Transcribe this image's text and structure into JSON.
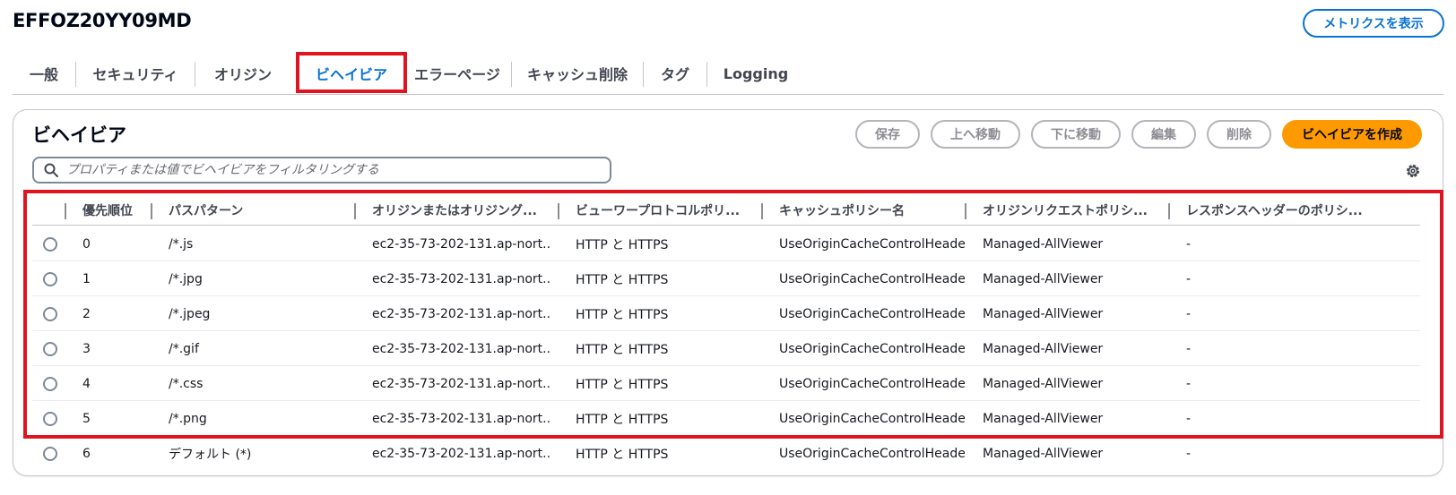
{
  "header": {
    "title": "EFFOZ20YY09MD",
    "metrics_button": "メトリクスを表示"
  },
  "tabs": [
    {
      "label": "一般",
      "active": false
    },
    {
      "label": "セキュリティ",
      "active": false
    },
    {
      "label": "オリジン",
      "active": false
    },
    {
      "label": "ビヘイビア",
      "active": true
    },
    {
      "label": "エラーページ",
      "active": false
    },
    {
      "label": "キャッシュ削除",
      "active": false
    },
    {
      "label": "タグ",
      "active": false
    },
    {
      "label": "Logging",
      "active": false
    }
  ],
  "panel": {
    "title": "ビヘイビア",
    "actions": {
      "save": "保存",
      "move_up": "上へ移動",
      "move_down": "下に移動",
      "edit": "編集",
      "delete": "削除",
      "create": "ビヘイビアを作成"
    },
    "filter_placeholder": "プロパティまたは値でビヘイビアをフィルタリングする"
  },
  "table": {
    "columns": [
      "優先順位",
      "パスパターン",
      "オリジンまたはオリジング...",
      "ビューワープロトコルポリ...",
      "キャッシュポリシー名",
      "オリジンリクエストポリシ...",
      "レスポンスヘッダーのポリシ..."
    ],
    "rows": [
      {
        "priority": "0",
        "path": "/*.js",
        "origin": "ec2-35-73-202-131.ap-nort...",
        "protocol": "HTTP と HTTPS",
        "cache_policy": "UseOriginCacheControlHeaders-Q",
        "origin_request": "Managed-AllViewer",
        "response_headers": "-"
      },
      {
        "priority": "1",
        "path": "/*.jpg",
        "origin": "ec2-35-73-202-131.ap-nort...",
        "protocol": "HTTP と HTTPS",
        "cache_policy": "UseOriginCacheControlHeaders-Q",
        "origin_request": "Managed-AllViewer",
        "response_headers": "-"
      },
      {
        "priority": "2",
        "path": "/*.jpeg",
        "origin": "ec2-35-73-202-131.ap-nort...",
        "protocol": "HTTP と HTTPS",
        "cache_policy": "UseOriginCacheControlHeaders-Q",
        "origin_request": "Managed-AllViewer",
        "response_headers": "-"
      },
      {
        "priority": "3",
        "path": "/*.gif",
        "origin": "ec2-35-73-202-131.ap-nort...",
        "protocol": "HTTP と HTTPS",
        "cache_policy": "UseOriginCacheControlHeaders-Q",
        "origin_request": "Managed-AllViewer",
        "response_headers": "-"
      },
      {
        "priority": "4",
        "path": "/*.css",
        "origin": "ec2-35-73-202-131.ap-nort...",
        "protocol": "HTTP と HTTPS",
        "cache_policy": "UseOriginCacheControlHeaders-Q",
        "origin_request": "Managed-AllViewer",
        "response_headers": "-"
      },
      {
        "priority": "5",
        "path": "/*.png",
        "origin": "ec2-35-73-202-131.ap-nort...",
        "protocol": "HTTP と HTTPS",
        "cache_policy": "UseOriginCacheControlHeaders-Q",
        "origin_request": "Managed-AllViewer",
        "response_headers": "-"
      },
      {
        "priority": "6",
        "path": "デフォルト (*)",
        "origin": "ec2-35-73-202-131.ap-nort...",
        "protocol": "HTTP と HTTPS",
        "cache_policy": "UseOriginCacheControlHeaders",
        "origin_request": "Managed-AllViewer",
        "response_headers": "-"
      }
    ]
  },
  "colors": {
    "accent": "#0972d3",
    "primary_button": "#ff9900",
    "highlight": "#e0141e"
  }
}
